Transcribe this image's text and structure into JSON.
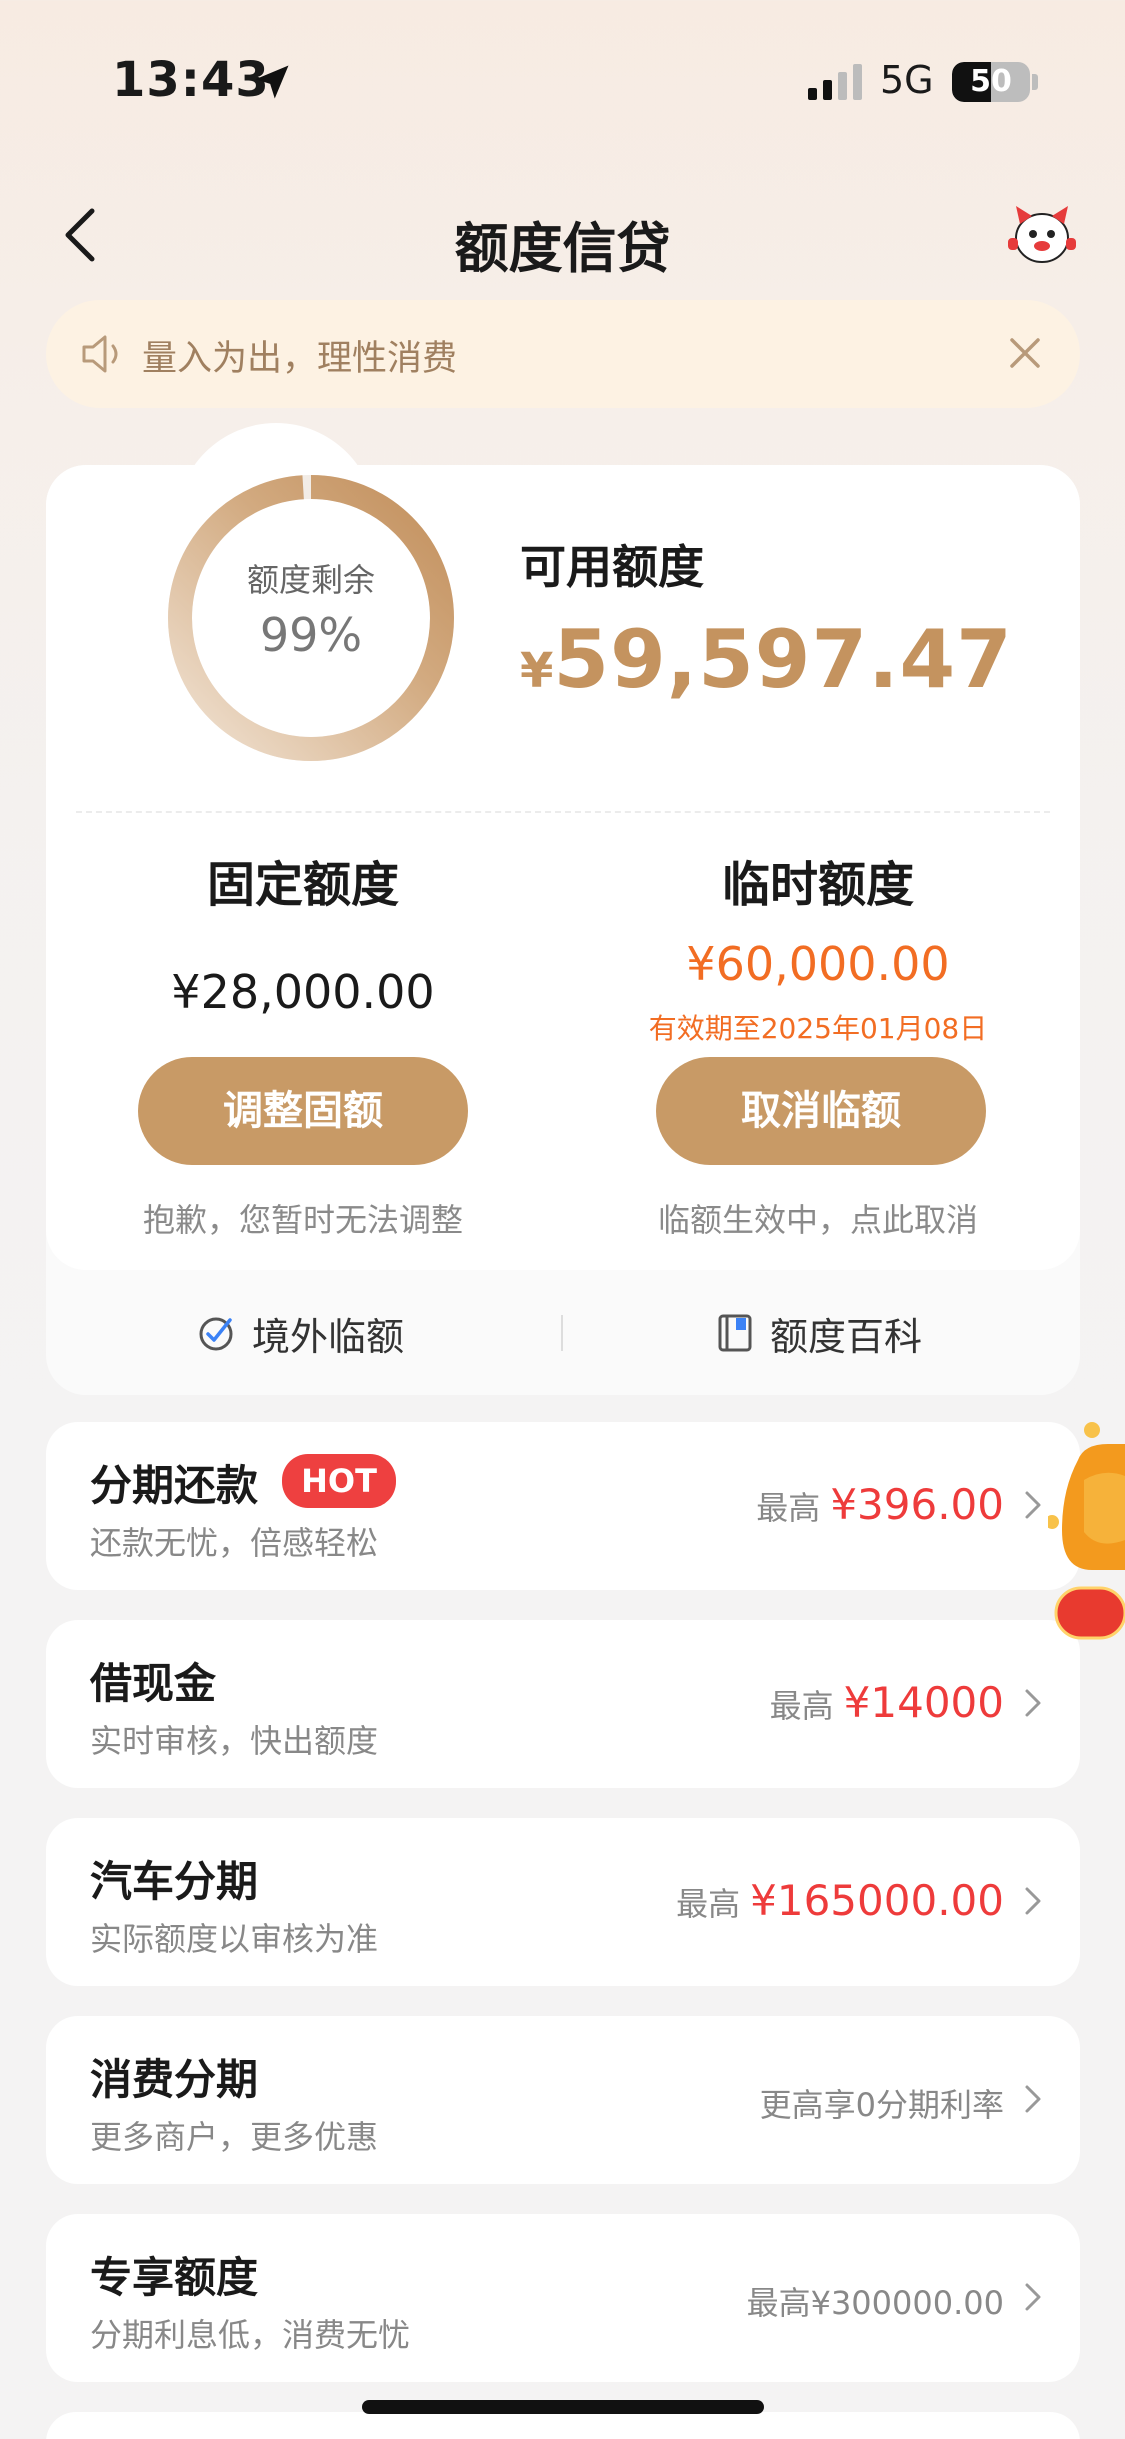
{
  "status_bar": {
    "time": "13:43",
    "network": "5G",
    "battery_percent": 50,
    "battery_label": "50"
  },
  "nav": {
    "title": "额度信贷"
  },
  "notice": {
    "text": "量入为出，理性消费"
  },
  "credit": {
    "ring_label": "额度剩余",
    "ring_percent_label": "99%",
    "ring_fraction": 0.99,
    "available_title": "可用额度",
    "available_currency": "¥",
    "available_value": "59,597.47",
    "fixed": {
      "title": "固定额度",
      "amount": "¥28,000.00",
      "button": "调整固额",
      "hint": "抱歉，您暂时无法调整"
    },
    "temp": {
      "title": "临时额度",
      "amount": "¥60,000.00",
      "expiry": "有效期至2025年01月08日",
      "button": "取消临额",
      "hint": "临额生效中，点此取消"
    },
    "links": {
      "overseas": "境外临额",
      "wiki": "额度百科"
    }
  },
  "products": [
    {
      "title": "分期还款",
      "badge": "HOT",
      "subtitle": "还款无忧，倍感轻松",
      "prefix": "最高",
      "value": "¥396.00"
    },
    {
      "title": "借现金",
      "subtitle": "实时审核，快出额度",
      "prefix": "最高",
      "value": "¥14000"
    },
    {
      "title": "汽车分期",
      "subtitle": "实际额度以审核为准",
      "prefix": "最高",
      "value": "¥165000.00"
    },
    {
      "title": "消费分期",
      "subtitle": "更多商户，更多优惠",
      "note": "更高享0分期利率"
    },
    {
      "title": "专享额度",
      "subtitle": "分期利息低，消费无忧",
      "note": "最高¥300000.00"
    }
  ],
  "colors": {
    "accent": "#c89a66",
    "red": "#ee3b3b",
    "orange": "#f26d23",
    "notice_bg": "#fdf2e3"
  },
  "icons": [
    "location-arrow-icon",
    "signal-icon",
    "battery-icon",
    "back-icon",
    "mascot-icon",
    "speaker-icon",
    "close-icon",
    "globe-icon",
    "book-icon",
    "chevron-right-icon",
    "red-envelope-icon"
  ]
}
